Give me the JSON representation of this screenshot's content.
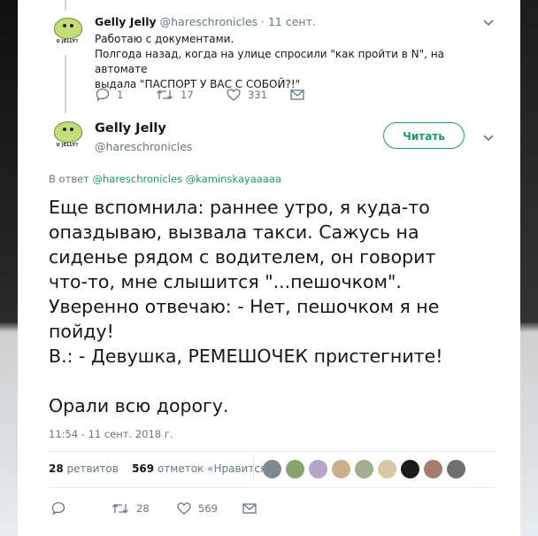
{
  "parent_tweet": {
    "author_name": "Gelly Jelly",
    "handle": "@hareschronicles",
    "date": "· 11 сент.",
    "lines": [
      "Работаю с документами.",
      "Полгода назад, когда на улице спросили \"как пройти в N\", на автомате",
      "выдала \"ПАСПОРТ У ВАС С СОБОЙ?!\""
    ],
    "avatar_tag": "U JELLY?",
    "replies": "1",
    "retweets": "17",
    "likes": "331"
  },
  "main_tweet": {
    "author_name": "Gelly Jelly",
    "handle": "@hareschronicles",
    "avatar_tag": "U JELLY?",
    "follow_label": "Читать",
    "reply_prefix": "В ответ",
    "reply_mentions": "@hareschronicles @kaminskayaaaaa",
    "text": "Еще вспомнила: раннее утро, я куда-то\nопаздываю, вызвала такси. Сажусь на\nсиденье рядом с водителем, он говорит\nчто-то, мне слышится \"...пешочком\".\nУверенно отвечаю: - Нет, пешочком я не\nпойду!\nВ.: - Девушка, РЕМЕШОЧЕК пристегните!\n\nОрали всю дорогу.",
    "timestamp": "11:54 - 11 сент. 2018 г.",
    "retweet_count": "28",
    "retweet_label": "ретвитов",
    "like_count": "569",
    "like_label": "отметок «Нравится»",
    "action_retweets": "28",
    "action_likes": "569"
  },
  "likers": [
    {
      "icon": "liker-avatar",
      "color": "#7d8a93"
    },
    {
      "icon": "liker-avatar",
      "color": "#8aa36b"
    },
    {
      "icon": "liker-avatar",
      "color": "#b7a4c9"
    },
    {
      "icon": "liker-avatar",
      "color": "#c9b08a"
    },
    {
      "icon": "liker-avatar",
      "color": "#9fae8c"
    },
    {
      "icon": "liker-avatar",
      "color": "#d8c7a3"
    },
    {
      "icon": "liker-avatar",
      "color": "#1b1b1b"
    },
    {
      "icon": "liker-avatar",
      "color": "#a67c6d"
    },
    {
      "icon": "liker-avatar",
      "color": "#6f6f6f"
    }
  ],
  "colors": {
    "accent": "#1c9a60",
    "muted": "#657786",
    "text": "#14171a"
  }
}
